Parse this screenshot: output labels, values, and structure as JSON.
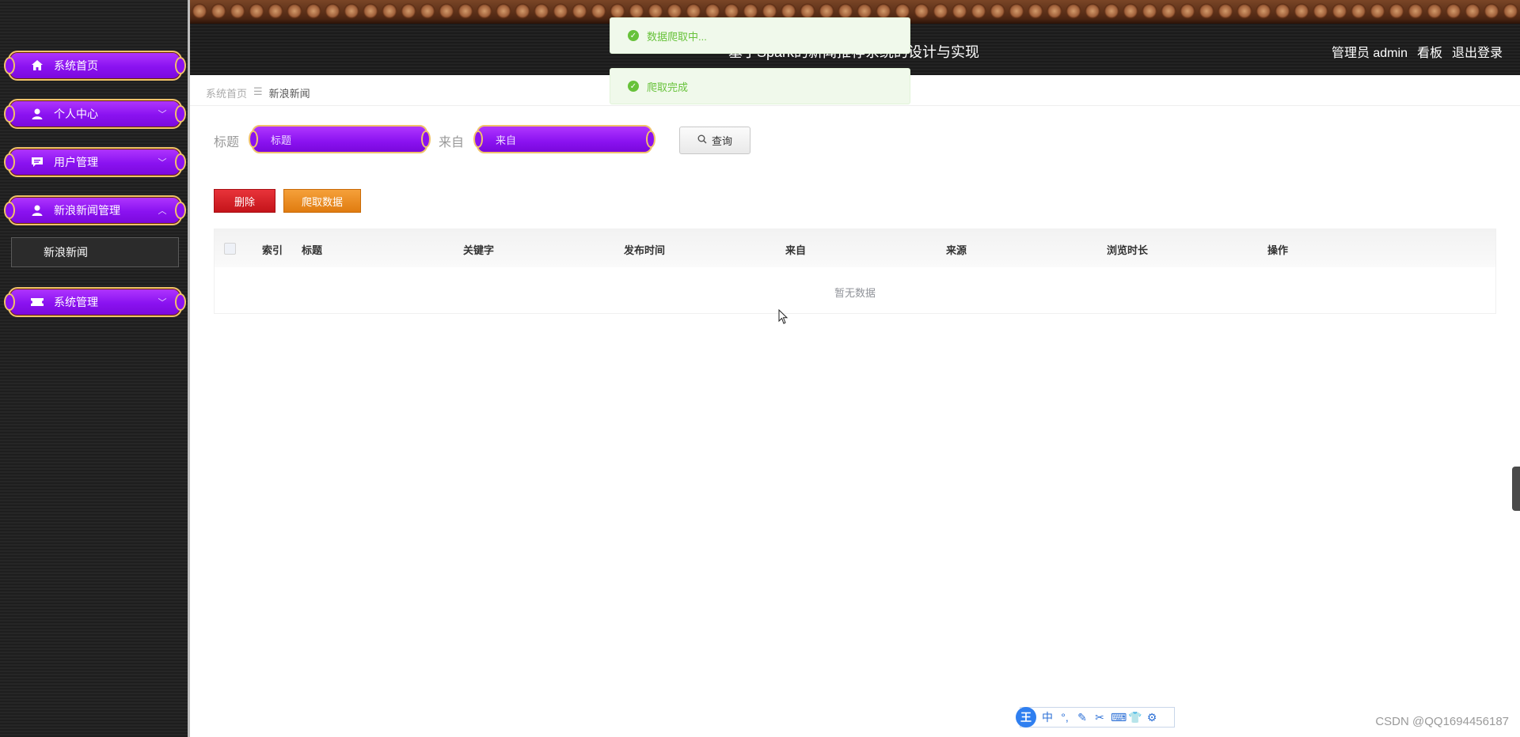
{
  "header": {
    "title": "基于Spark的新闻推荐系统的设计与实现",
    "user_label": "管理员 admin",
    "dashboard_link": "看板",
    "logout_link": "退出登录"
  },
  "sidebar": {
    "items": [
      {
        "label": "系统首页",
        "icon": "home-icon",
        "chevron": ""
      },
      {
        "label": "个人中心",
        "icon": "user-icon",
        "chevron": "﹀"
      },
      {
        "label": "用户管理",
        "icon": "chat-icon",
        "chevron": "﹀"
      },
      {
        "label": "新浪新闻管理",
        "icon": "user-icon",
        "chevron": "︿"
      },
      {
        "label": "系统管理",
        "icon": "ticket-icon",
        "chevron": "﹀"
      }
    ],
    "sub_item": "新浪新闻"
  },
  "breadcrumb": {
    "home": "系统首页",
    "separator": "☰",
    "current": "新浪新闻"
  },
  "search": {
    "title_label": "标题",
    "title_placeholder": "标题",
    "source_label": "来自",
    "source_placeholder": "来自",
    "query_button": "查询"
  },
  "actions": {
    "delete": "删除",
    "crawl": "爬取数据"
  },
  "table": {
    "columns": [
      "索引",
      "标题",
      "关键字",
      "发布时间",
      "来自",
      "来源",
      "浏览时长",
      "操作"
    ],
    "empty_text": "暂无数据"
  },
  "toasts": [
    {
      "text": "数据爬取中..."
    },
    {
      "text": "爬取完成"
    }
  ],
  "ime": {
    "logo": "王",
    "glyphs": [
      "中",
      "°,",
      "✎",
      "✂",
      "⌨",
      "👕",
      "⚙"
    ]
  },
  "watermark": "CSDN @QQ1694456187",
  "colors": {
    "menu_purple": "#8a12f0",
    "menu_border_gold": "#f0c26a",
    "delete_red": "#c4141a",
    "crawl_orange": "#e07c10",
    "toast_green": "#67c23a"
  }
}
